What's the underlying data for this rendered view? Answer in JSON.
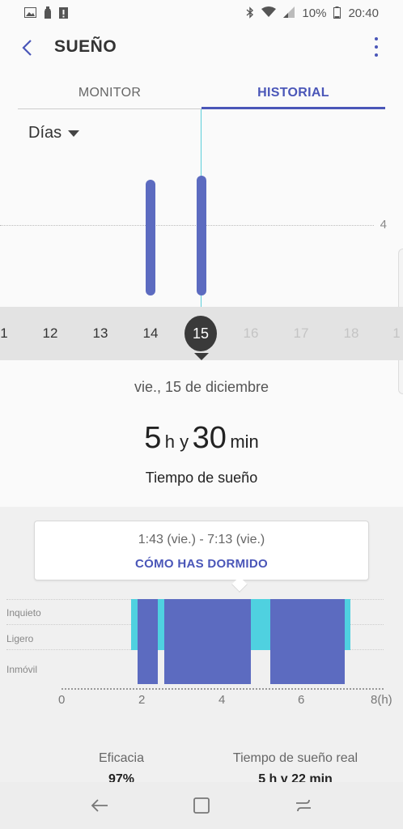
{
  "status_bar": {
    "battery": "10%",
    "time": "20:40",
    "left_icons": [
      "image-icon",
      "bottle-icon",
      "alert-icon"
    ],
    "right_icons": [
      "bluetooth-icon",
      "wifi-icon",
      "signal-icon",
      "battery-icon"
    ]
  },
  "app_bar": {
    "title": "SUEÑO",
    "back_icon": "chevron-left-icon",
    "more_icon": "more-vertical-icon"
  },
  "tabs": [
    {
      "label": "MONITOR",
      "selected": false
    },
    {
      "label": "HISTORIAL",
      "selected": true
    }
  ],
  "range_selector": {
    "value": "Días"
  },
  "chart": {
    "reference_value": "4",
    "bars": [
      {
        "day": "14",
        "hours": 5.3
      },
      {
        "day": "15",
        "hours": 5.5
      }
    ]
  },
  "days": [
    {
      "label": "1",
      "state": "past"
    },
    {
      "label": "12",
      "state": "past"
    },
    {
      "label": "13",
      "state": "past"
    },
    {
      "label": "14",
      "state": "past"
    },
    {
      "label": "15",
      "state": "selected"
    },
    {
      "label": "16",
      "state": "future"
    },
    {
      "label": "17",
      "state": "future"
    },
    {
      "label": "18",
      "state": "future"
    },
    {
      "label": "1",
      "state": "future"
    }
  ],
  "summary": {
    "date": "vie., 15 de diciembre",
    "hours": "5",
    "hours_unit": "h y",
    "minutes": "30",
    "minutes_unit": "min",
    "label": "Tiempo de sueño"
  },
  "detail": {
    "time_range": "1:43 (vie.) - 7:13 (vie.)",
    "link": "CÓMO HAS DORMIDO",
    "stages": [
      "Inquieto",
      "Ligero",
      "Inmóvil"
    ],
    "axis_labels": [
      "0",
      "2",
      "4",
      "6",
      "8(h)"
    ],
    "efficiency_label": "Eficacia",
    "efficiency_value": "97%",
    "real_sleep_label": "Tiempo de sueño real",
    "real_sleep_value": "5 h y 22 min"
  },
  "colors": {
    "accent": "#4a56b8",
    "bar": "#5c6bc0",
    "light_sleep": "#4fd1e0",
    "selected_day": "#3a3a3a"
  },
  "nav_bar": [
    "back-icon",
    "home-icon",
    "recents-icon"
  ]
}
